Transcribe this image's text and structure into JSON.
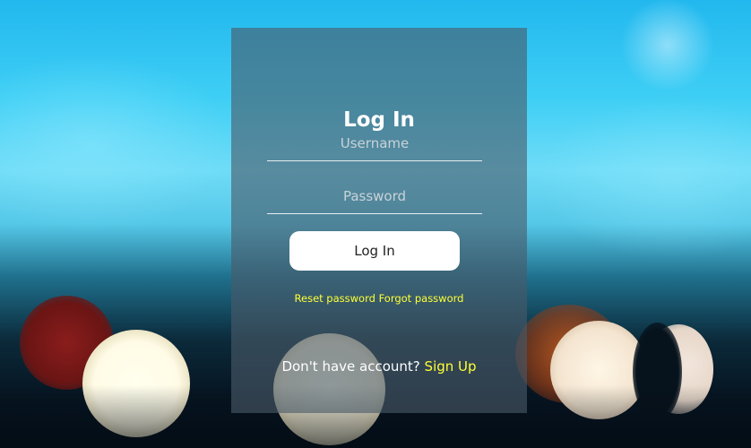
{
  "login": {
    "title": "Log In",
    "username_placeholder": "Username",
    "password_placeholder": "Password",
    "button_label": "Log In",
    "reset_password_link": "Reset password",
    "forgot_password_link": "Forgot password",
    "no_account_text": "Don't have account?",
    "signup_link": "Sign Up"
  },
  "colors": {
    "link": "#ffff33",
    "panel": "#4b5a69",
    "button": "#ffffff"
  }
}
